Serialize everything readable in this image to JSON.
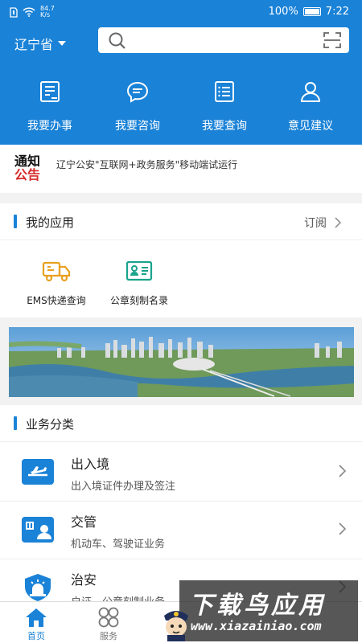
{
  "status_bar": {
    "net_speed": "84.7\nK/s",
    "battery": "100%",
    "time": "7:22"
  },
  "header": {
    "province": "辽宁省",
    "quick_actions": [
      {
        "label": "我要办事",
        "icon": "form-icon"
      },
      {
        "label": "我要咨询",
        "icon": "chat-icon"
      },
      {
        "label": "我要查询",
        "icon": "list-icon"
      },
      {
        "label": "意见建议",
        "icon": "person-icon"
      }
    ]
  },
  "notice": {
    "badge_top": "通知",
    "badge_bottom": "公告",
    "text": "辽宁公安\"互联网+政务服务\"移动端试运行"
  },
  "my_apps": {
    "title": "我的应用",
    "subscribe": "订阅",
    "items": [
      {
        "label": "EMS快递查询",
        "icon": "truck-icon"
      },
      {
        "label": "公章刻制名录",
        "icon": "id-card-icon"
      }
    ]
  },
  "business": {
    "title": "业务分类",
    "items": [
      {
        "name": "出入境",
        "desc": "出入境证件办理及签注",
        "icon": "plane-icon"
      },
      {
        "name": "交管",
        "desc": "机动车、驾驶证业务",
        "icon": "license-icon"
      },
      {
        "name": "治安",
        "desc": "户证、公章刻制业务",
        "icon": "police-light-icon"
      }
    ]
  },
  "tabbar": {
    "items": [
      {
        "label": "首页",
        "icon": "home-icon"
      },
      {
        "label": "服务",
        "icon": "grid-icon"
      },
      {
        "label": "",
        "icon": "mascot-icon"
      },
      {
        "label": "",
        "icon": ""
      },
      {
        "label": "",
        "icon": ""
      }
    ]
  },
  "watermark": {
    "title": "下载鸟应用",
    "url": "www.xiazainiao.com"
  },
  "colors": {
    "primary": "#1a82d7",
    "notice_red": "#d72b2b",
    "app_orange": "#e8a020",
    "app_teal": "#1aa38c"
  }
}
